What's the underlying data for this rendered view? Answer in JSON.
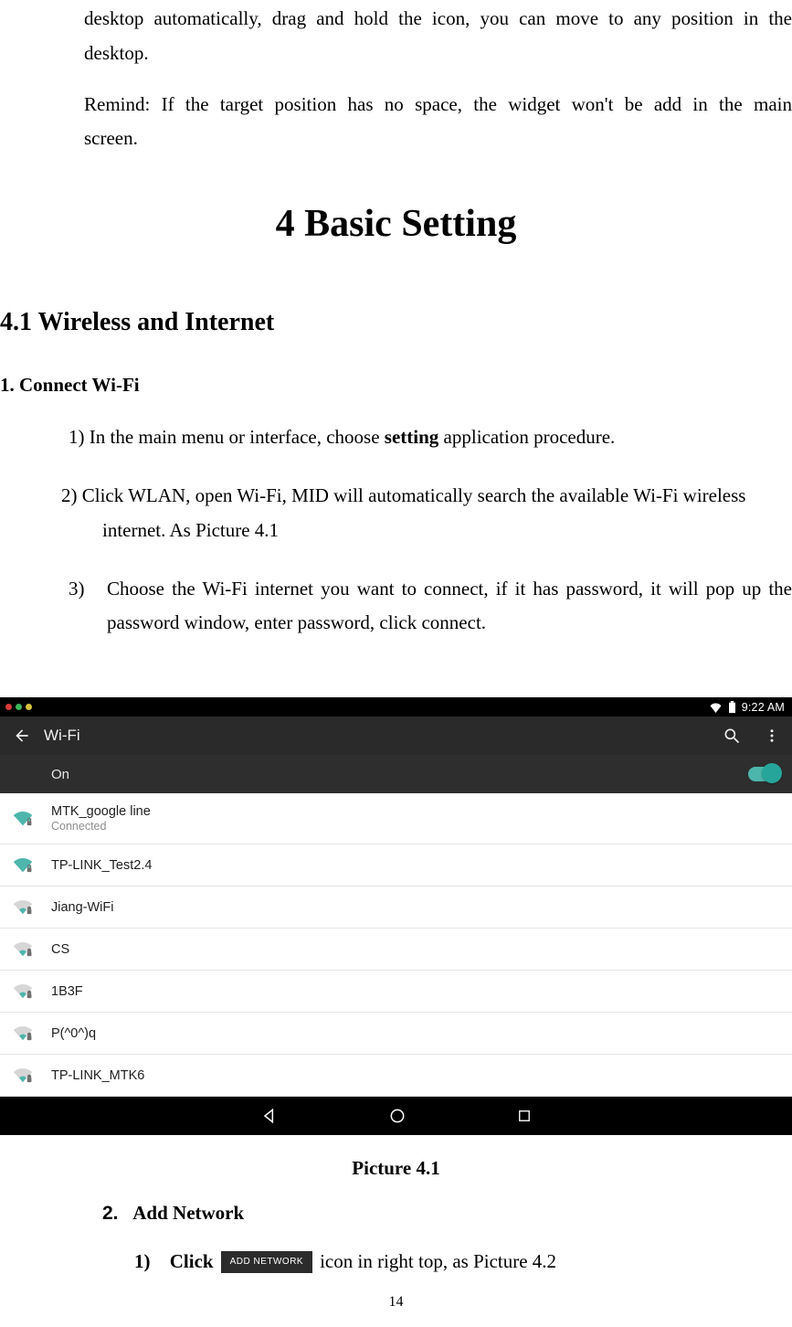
{
  "para1": "desktop automatically, drag and hold the icon, you can move to any position in the desktop.",
  "para2": "Remind: If the target position has no space, the widget won't be add in the main screen.",
  "chapter_title": "4 Basic Setting",
  "section_title": "4.1 Wireless and Internet",
  "subsection_title": "1. Connect Wi-Fi",
  "step1_a": "1) In the main menu or interface, choose ",
  "step1_bold": "setting",
  "step1_b": " application procedure.",
  "step2_a": "2) Click WLAN, open Wi-Fi, MID will automatically search the available Wi-Fi wireless",
  "step2_b": "internet. As Picture 4.1",
  "step3_num": "3)",
  "step3_body": "Choose the Wi-Fi internet you want to connect, if it has password, it will pop up the password window, enter password, click connect.",
  "screenshot": {
    "status_time": "9:22 AM",
    "appbar_title": "Wi-Fi",
    "on_label": "On",
    "networks": [
      {
        "ssid": "MTK_google line",
        "sub": "Connected",
        "strength": "strong"
      },
      {
        "ssid": "TP-LINK_Test2.4",
        "sub": "",
        "strength": "strong"
      },
      {
        "ssid": "Jiang-WiFi",
        "sub": "",
        "strength": "weak"
      },
      {
        "ssid": "CS",
        "sub": "",
        "strength": "weak"
      },
      {
        "ssid": "1B3F",
        "sub": "",
        "strength": "weak"
      },
      {
        "ssid": "P(^0^)q",
        "sub": "",
        "strength": "weak"
      },
      {
        "ssid": "TP-LINK_MTK6",
        "sub": "",
        "strength": "weak"
      }
    ]
  },
  "caption": "Picture 4.1",
  "addnet_num": "2.",
  "addnet_label": "Add Network",
  "sub_num": "1)",
  "sub_click": "Click",
  "addnet_badge": "ADD NETWORK",
  "sub_tail": " icon in right top, as Picture 4.2",
  "page_number": "14"
}
